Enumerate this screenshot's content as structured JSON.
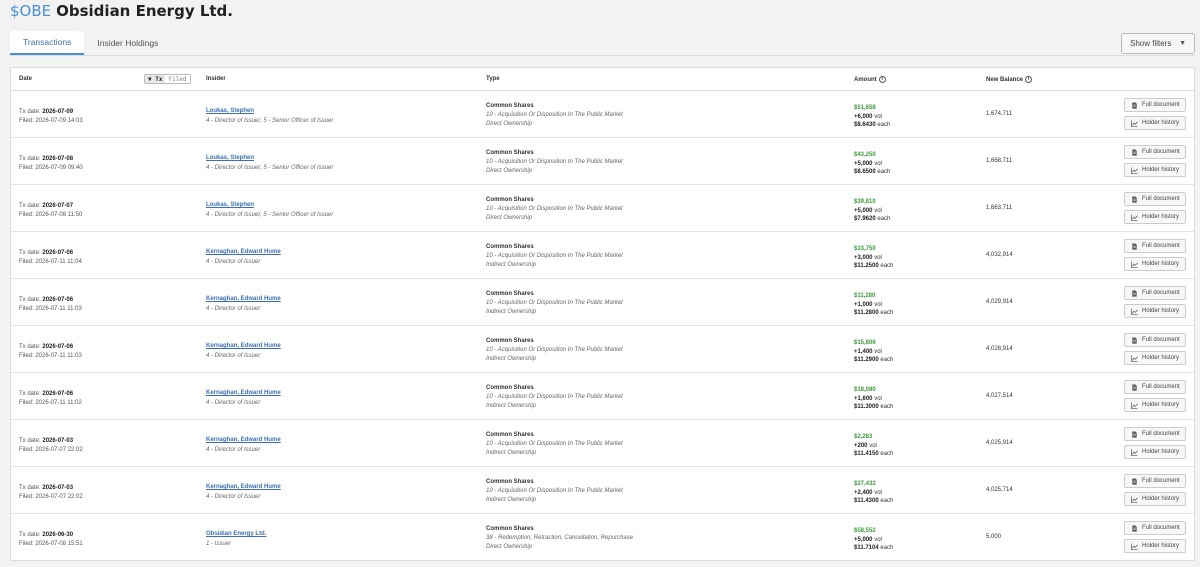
{
  "header": {
    "ticker": "$OBE",
    "company": "Obsidian Energy Ltd."
  },
  "tabs": [
    {
      "label": "Transactions",
      "active": true
    },
    {
      "label": "Insider Holdings",
      "active": false
    }
  ],
  "filters": {
    "label": "Show filters"
  },
  "columns": {
    "date": "Date",
    "toggle_tx": "▼ Tx",
    "toggle_filed": "Filed",
    "insider": "Insider",
    "type": "Type",
    "amount": "Amount",
    "balance": "New Balance"
  },
  "labels": {
    "tx_date": "Tx date:",
    "filed": "Filed:",
    "vol_suffix": "vol",
    "each_suffix": "each",
    "full_document": "Full document",
    "holder_history": "Holder history"
  },
  "rows": [
    {
      "tx_date": "2026-07-09",
      "filed": "2026-07-09 14:03",
      "insider": "Loukas, Stephen",
      "role": "4 - Director of Issuer, 5 - Senior Officer of Issuer",
      "security": "Common Shares",
      "code": "10 - Acquisition Or Disposition In The Public Market",
      "ownership": "Direct Ownership",
      "value": "$51,858",
      "volume": "+6,000",
      "price": "$8.6430",
      "balance": "1,674,711"
    },
    {
      "tx_date": "2026-07-08",
      "filed": "2026-07-09 09:40",
      "insider": "Loukas, Stephen",
      "role": "4 - Director of Issuer, 5 - Senior Officer of Issuer",
      "security": "Common Shares",
      "code": "10 - Acquisition Or Disposition In The Public Market",
      "ownership": "Direct Ownership",
      "value": "$43,250",
      "volume": "+5,000",
      "price": "$8.6500",
      "balance": "1,668,711"
    },
    {
      "tx_date": "2026-07-07",
      "filed": "2026-07-08 11:50",
      "insider": "Loukas, Stephen",
      "role": "4 - Director of Issuer, 5 - Senior Officer of Issuer",
      "security": "Common Shares",
      "code": "10 - Acquisition Or Disposition In The Public Market",
      "ownership": "Direct Ownership",
      "value": "$39,810",
      "volume": "+5,000",
      "price": "$7.9620",
      "balance": "1,663,711"
    },
    {
      "tx_date": "2026-07-06",
      "filed": "2026-07-11 11:04",
      "insider": "Kernaghan, Edward Hume",
      "role": "4 - Director of Issuer",
      "security": "Common Shares",
      "code": "10 - Acquisition Or Disposition In The Public Market",
      "ownership": "Indirect Ownership",
      "value": "$33,750",
      "volume": "+3,000",
      "price": "$11.2500",
      "balance": "4,032,914"
    },
    {
      "tx_date": "2026-07-06",
      "filed": "2026-07-11 11:03",
      "insider": "Kernaghan, Edward Hume",
      "role": "4 - Director of Issuer",
      "security": "Common Shares",
      "code": "10 - Acquisition Or Disposition In The Public Market",
      "ownership": "Indirect Ownership",
      "value": "$11,280",
      "volume": "+1,000",
      "price": "$11.2800",
      "balance": "4,029,914"
    },
    {
      "tx_date": "2026-07-06",
      "filed": "2026-07-11 11:03",
      "insider": "Kernaghan, Edward Hume",
      "role": "4 - Director of Issuer",
      "security": "Common Shares",
      "code": "10 - Acquisition Or Disposition In The Public Market",
      "ownership": "Indirect Ownership",
      "value": "$15,806",
      "volume": "+1,400",
      "price": "$11.2900",
      "balance": "4,028,914"
    },
    {
      "tx_date": "2026-07-06",
      "filed": "2026-07-11 11:02",
      "insider": "Kernaghan, Edward Hume",
      "role": "4 - Director of Issuer",
      "security": "Common Shares",
      "code": "10 - Acquisition Or Disposition In The Public Market",
      "ownership": "Indirect Ownership",
      "value": "$18,080",
      "volume": "+1,600",
      "price": "$11.3000",
      "balance": "4,027,514"
    },
    {
      "tx_date": "2026-07-03",
      "filed": "2026-07-07 22:02",
      "insider": "Kernaghan, Edward Hume",
      "role": "4 - Director of Issuer",
      "security": "Common Shares",
      "code": "10 - Acquisition Or Disposition In The Public Market",
      "ownership": "Indirect Ownership",
      "value": "$2,283",
      "volume": "+200",
      "price": "$11.4150",
      "balance": "4,025,914"
    },
    {
      "tx_date": "2026-07-03",
      "filed": "2026-07-07 22:02",
      "insider": "Kernaghan, Edward Hume",
      "role": "4 - Director of Issuer",
      "security": "Common Shares",
      "code": "10 - Acquisition Or Disposition In The Public Market",
      "ownership": "Indirect Ownership",
      "value": "$27,432",
      "volume": "+2,400",
      "price": "$11.4300",
      "balance": "4,025,714"
    },
    {
      "tx_date": "2026-06-30",
      "filed": "2026-07-08 15:51",
      "insider": "Obsidian Energy Ltd.",
      "role": "1 - Issuer",
      "security": "Common Shares",
      "code": "38 - Redemption, Retraction, Cancellation, Repurchase",
      "ownership": "Direct Ownership",
      "value": "$58,552",
      "volume": "+5,000",
      "price": "$11.7104",
      "balance": "5,000"
    }
  ],
  "colors": {
    "accent": "#4a90d9",
    "link": "#3b6fb6",
    "positive": "#3a9a3a"
  },
  "icons": {
    "document": "document-icon",
    "history": "chart-line-icon",
    "info": "info-icon",
    "caret": "caret-down-icon"
  }
}
